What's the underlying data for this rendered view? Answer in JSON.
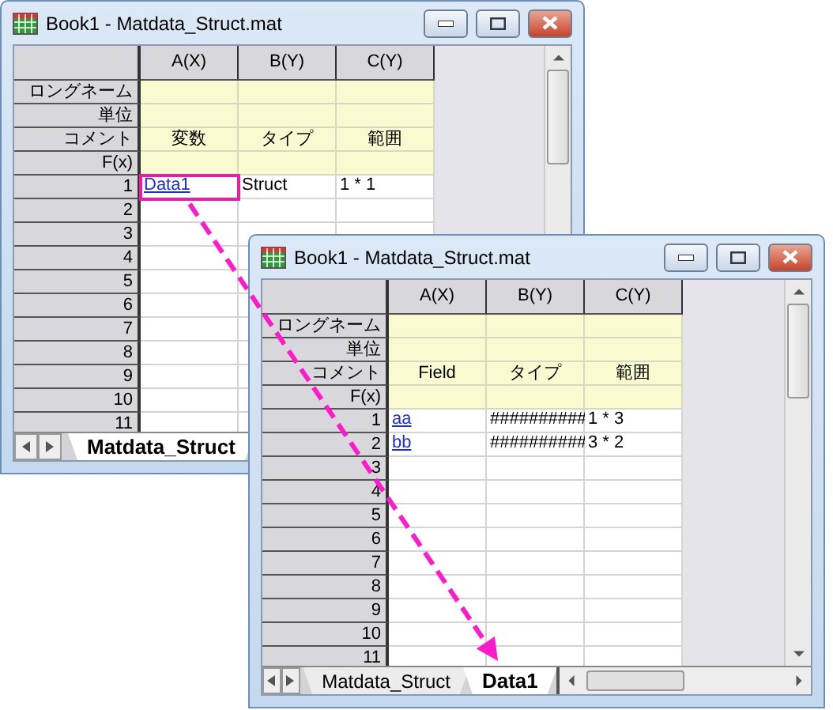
{
  "windows": [
    {
      "title": "Book1 - Matdata_Struct.mat",
      "columns": [
        "A(X)",
        "B(Y)",
        "C(Y)"
      ],
      "label_rows": [
        {
          "label": "ロングネーム"
        },
        {
          "label": "単位"
        },
        {
          "label": "コメント",
          "values": [
            "変数",
            "タイプ",
            "範囲"
          ]
        },
        {
          "label": "F(x)"
        }
      ],
      "rows": [
        {
          "number": "1",
          "cells": [
            {
              "text": "Data1",
              "kind": "link",
              "highlighted": true
            },
            {
              "text": "Struct",
              "kind": "text"
            },
            {
              "text": "1 * 1",
              "kind": "text"
            }
          ]
        },
        {
          "number": "2"
        },
        {
          "number": "3"
        },
        {
          "number": "4"
        },
        {
          "number": "5"
        },
        {
          "number": "6"
        },
        {
          "number": "7"
        },
        {
          "number": "8"
        },
        {
          "number": "9"
        },
        {
          "number": "10"
        },
        {
          "number": "11"
        }
      ],
      "sheet_tabs": [
        {
          "label": "Matdata_Struct",
          "selected": true
        }
      ]
    },
    {
      "title": "Book1 - Matdata_Struct.mat",
      "columns": [
        "A(X)",
        "B(Y)",
        "C(Y)"
      ],
      "label_rows": [
        {
          "label": "ロングネーム"
        },
        {
          "label": "単位"
        },
        {
          "label": "コメント",
          "values": [
            "Field",
            "タイプ",
            "範囲"
          ]
        },
        {
          "label": "F(x)"
        }
      ],
      "rows": [
        {
          "number": "1",
          "cells": [
            {
              "text": "aa",
              "kind": "link"
            },
            {
              "text": "##########",
              "kind": "text"
            },
            {
              "text": "1 * 3",
              "kind": "text"
            }
          ]
        },
        {
          "number": "2",
          "cells": [
            {
              "text": "bb",
              "kind": "link"
            },
            {
              "text": "##########",
              "kind": "text"
            },
            {
              "text": "3 * 2",
              "kind": "text"
            }
          ]
        },
        {
          "number": "3"
        },
        {
          "number": "4"
        },
        {
          "number": "5"
        },
        {
          "number": "6"
        },
        {
          "number": "7"
        },
        {
          "number": "8"
        },
        {
          "number": "9"
        },
        {
          "number": "10"
        },
        {
          "number": "11"
        }
      ],
      "sheet_tabs": [
        {
          "label": "Matdata_Struct",
          "selected": false
        },
        {
          "label": "Data1",
          "selected": true
        }
      ],
      "horizontal_scrollbar": true
    }
  ]
}
